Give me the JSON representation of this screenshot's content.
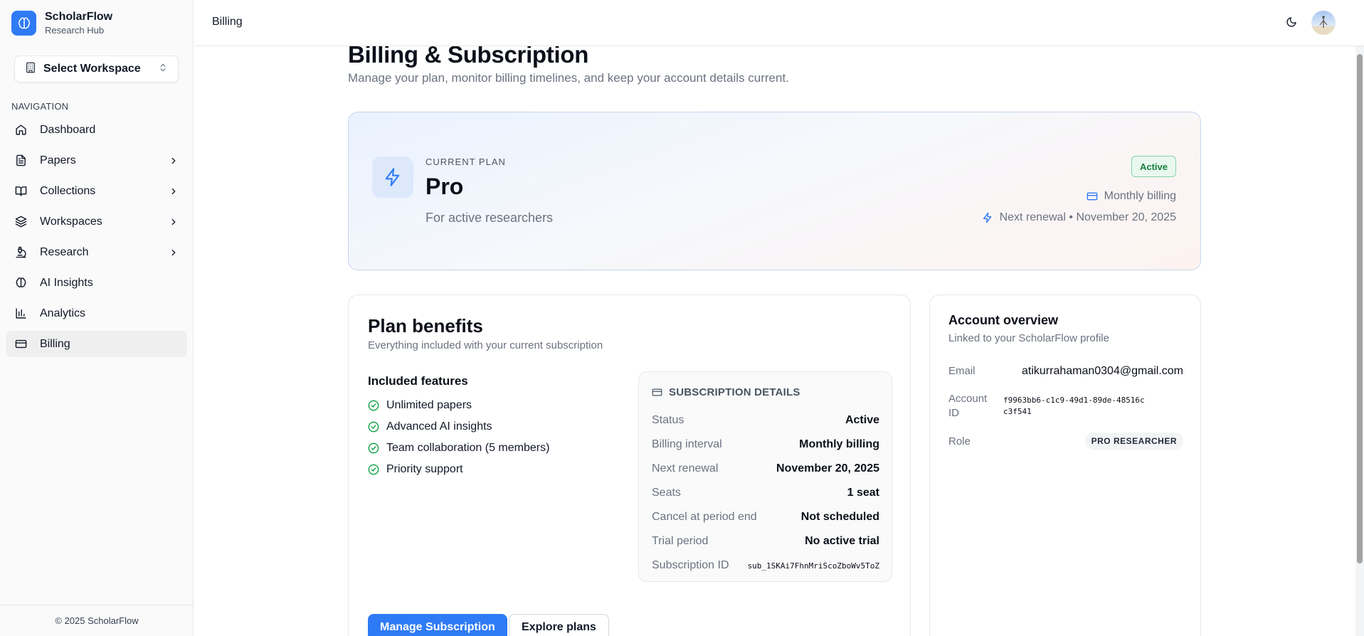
{
  "brand": {
    "name": "ScholarFlow",
    "subtitle": "Research Hub"
  },
  "workspace_select": {
    "label": "Select Workspace"
  },
  "nav": {
    "heading": "NAVIGATION",
    "items": [
      {
        "label": "Dashboard",
        "icon": "home-icon",
        "has_children": false,
        "active": false
      },
      {
        "label": "Papers",
        "icon": "document-icon",
        "has_children": true,
        "active": false
      },
      {
        "label": "Collections",
        "icon": "book-icon",
        "has_children": true,
        "active": false
      },
      {
        "label": "Workspaces",
        "icon": "layers-icon",
        "has_children": true,
        "active": false
      },
      {
        "label": "Research",
        "icon": "microscope-icon",
        "has_children": true,
        "active": false
      },
      {
        "label": "AI Insights",
        "icon": "brain-icon",
        "has_children": false,
        "active": false
      },
      {
        "label": "Analytics",
        "icon": "bar-chart-icon",
        "has_children": false,
        "active": false
      },
      {
        "label": "Billing",
        "icon": "credit-card-icon",
        "has_children": false,
        "active": true
      }
    ]
  },
  "footer": {
    "copyright": "© 2025 ScholarFlow"
  },
  "header": {
    "title": "Billing"
  },
  "page": {
    "title": "Billing & Subscription",
    "subtitle": "Manage your plan, monitor billing timelines, and keep your account details current."
  },
  "plan": {
    "eyebrow": "CURRENT PLAN",
    "name": "Pro",
    "description": "For active researchers",
    "status": "Active",
    "billing": "Monthly billing",
    "renewal": "Next renewal • November 20, 2025"
  },
  "benefits": {
    "title": "Plan benefits",
    "subtitle": "Everything included with your current subscription",
    "features_heading": "Included features",
    "features": [
      "Unlimited papers",
      "Advanced AI insights",
      "Team collaboration (5 members)",
      "Priority support"
    ]
  },
  "subscription_details": {
    "heading": "SUBSCRIPTION DETAILS",
    "rows": [
      {
        "key": "Status",
        "value": "Active"
      },
      {
        "key": "Billing interval",
        "value": "Monthly billing"
      },
      {
        "key": "Next renewal",
        "value": "November 20, 2025"
      },
      {
        "key": "Seats",
        "value": "1 seat"
      },
      {
        "key": "Cancel at period end",
        "value": "Not scheduled"
      },
      {
        "key": "Trial period",
        "value": "No active trial"
      },
      {
        "key": "Subscription ID",
        "value": "sub_1SKAi7FhnMriScoZboWv5ToZ"
      }
    ]
  },
  "buttons": {
    "manage": "Manage Subscription",
    "explore": "Explore plans"
  },
  "account": {
    "title": "Account overview",
    "subtitle": "Linked to your ScholarFlow profile",
    "email_label": "Email",
    "email": "atikurrahaman0304@gmail.com",
    "id_label": "Account ID",
    "id": "f9963bb6-c1c9-49d1-89de-48516cc3f541",
    "role_label": "Role",
    "role": "PRO RESEARCHER"
  },
  "colors": {
    "accent": "#2f7bf5",
    "success": "#16a34a"
  }
}
